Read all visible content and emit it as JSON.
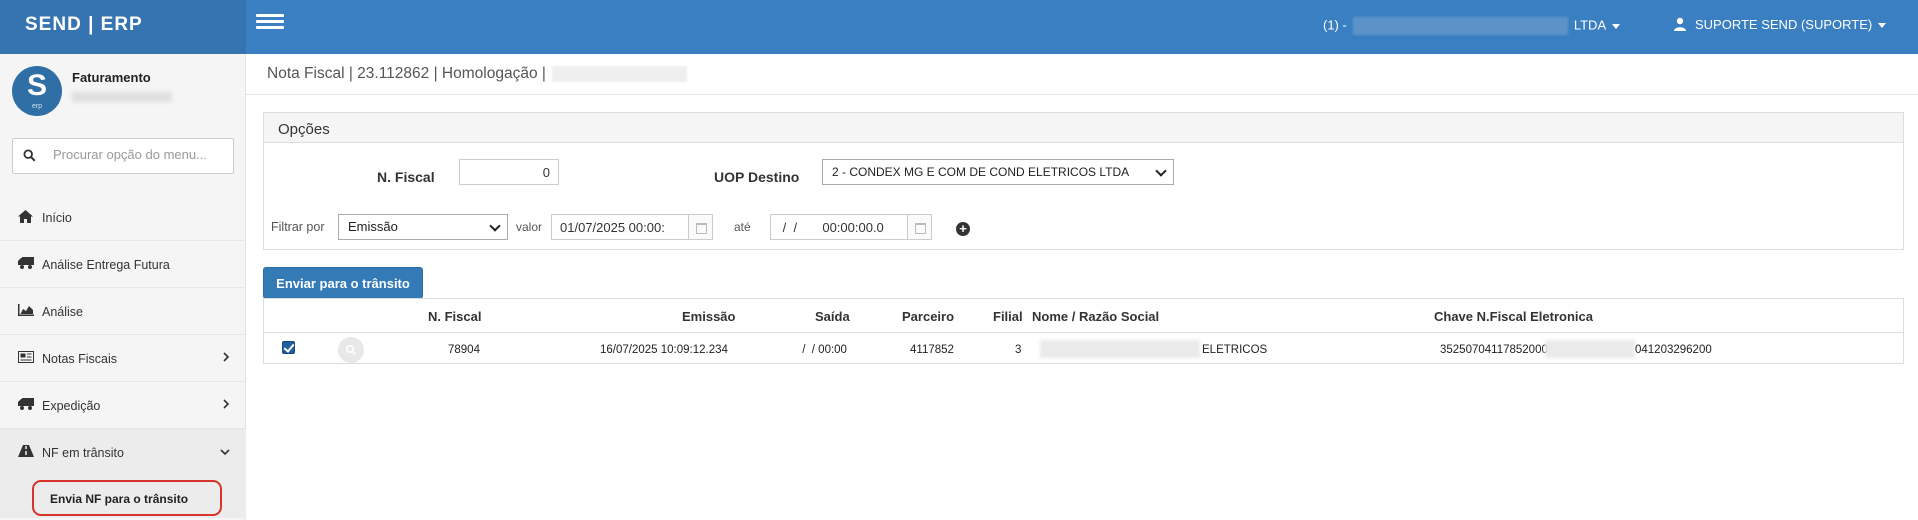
{
  "header": {
    "brand": "SEND | ERP",
    "company_prefix": "(1) -",
    "company_suffix": "LTDA",
    "user": "SUPORTE SEND (SUPORTE)"
  },
  "sidebar": {
    "profile_name": "Faturamento",
    "avatar_letter": "S",
    "avatar_sub": "erp",
    "search_placeholder": "Procurar opção do menu...",
    "items": [
      {
        "label": "Início",
        "icon": "home-icon"
      },
      {
        "label": "Análise Entrega Futura",
        "icon": "truck-icon"
      },
      {
        "label": "Análise",
        "icon": "area-chart-icon"
      },
      {
        "label": "Notas Fiscais",
        "icon": "newspaper-icon",
        "has_children": true
      },
      {
        "label": "Expedição",
        "icon": "truck-icon",
        "has_children": true
      },
      {
        "label": "NF em trânsito",
        "icon": "road-icon",
        "has_children": true,
        "expanded": true
      }
    ],
    "submenu": [
      {
        "label": "Envia NF para o trânsito"
      }
    ]
  },
  "page": {
    "title": "Nota Fiscal | 23.112862 | Homologação |"
  },
  "options": {
    "heading": "Opções",
    "nf_label": "N. Fiscal",
    "nf_value": "0",
    "uop_label": "UOP Destino",
    "uop_value": "2 - CONDEX MG E COM DE COND ELETRICOS LTDA",
    "filter_label": "Filtrar por",
    "filter_value": "Emissão",
    "valor_label": "valor",
    "valor_value": "01/07/2025 00:00:",
    "ate_label": "até",
    "ate_value": " /  /       00:00:00.0"
  },
  "actions": {
    "send_label": "Enviar para o trânsito"
  },
  "table": {
    "columns": [
      "N. Fiscal",
      "Emissão",
      "Saída",
      "Parceiro",
      "Filial",
      "Nome / Razão Social",
      "Chave N.Fiscal Eletronica"
    ],
    "rows": [
      {
        "checked": true,
        "nf": "78904",
        "emissao": "16/07/2025 10:09:12.234",
        "saida": " /  / 00:00",
        "parceiro": "4117852",
        "filial": "3",
        "nome": "ELETRICOS",
        "chave_start": "352507041178520001",
        "chave_end": "041203296200"
      }
    ]
  },
  "colors": {
    "header": "#3a7fc1",
    "brand_bg": "#3574b1",
    "primary_button": "#337ab7",
    "highlight_outline": "#d9342b"
  }
}
